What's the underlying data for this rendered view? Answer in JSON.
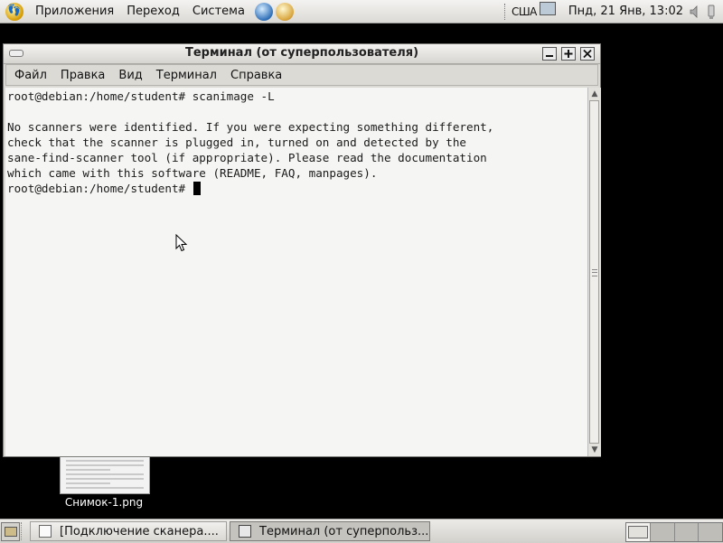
{
  "top_panel": {
    "menus": [
      "Приложения",
      "Переход",
      "Система"
    ],
    "icons": [
      "gnome-foot-icon",
      "web-browser-icon",
      "mail-client-icon"
    ],
    "keyboard_layout": "США",
    "clock": "Пнд, 21 Янв, 13:02"
  },
  "window": {
    "title": "Терминал (от суперпользователя)",
    "menu": [
      "Файл",
      "Правка",
      "Вид",
      "Терминал",
      "Справка"
    ],
    "terminal_lines": [
      "root@debian:/home/student# scanimage -L",
      "",
      "No scanners were identified. If you were expecting something different,",
      "check that the scanner is plugged in, turned on and detected by the",
      "sane-find-scanner tool (if appropriate). Please read the documentation",
      "which came with this software (README, FAQ, manpages).",
      "root@debian:/home/student# "
    ]
  },
  "desktop": {
    "icon_label": "Снимок-1.png"
  },
  "taskbar": {
    "tasks": [
      {
        "label": "[Подключение сканера....",
        "active": false
      },
      {
        "label": "Терминал (от суперпольз...",
        "active": true
      }
    ],
    "workspace_count": 4,
    "current_workspace": 1
  },
  "colors": {
    "desktop_bg": "#000000",
    "panel_bg": "#dcdad5",
    "terminal_bg": "#f5f5f3",
    "terminal_fg": "#1a1a1a"
  }
}
